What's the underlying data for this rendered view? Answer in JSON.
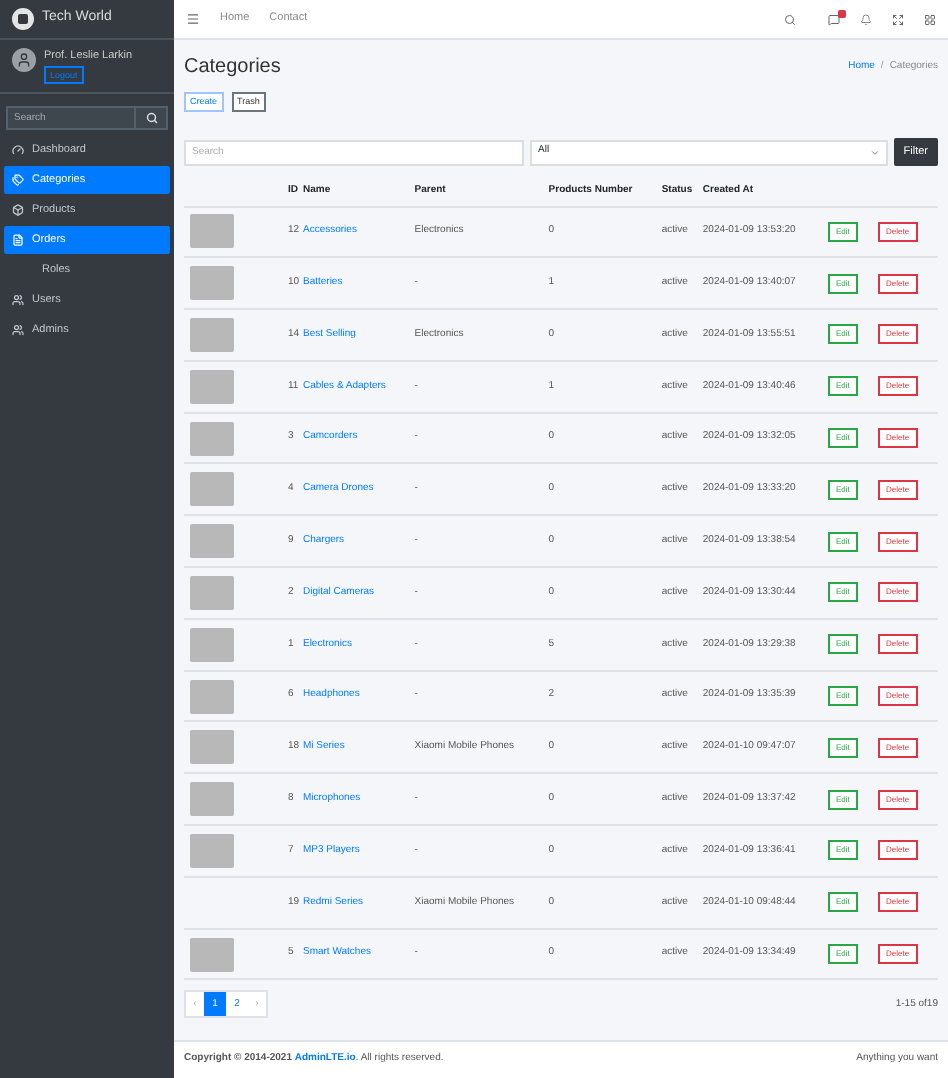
{
  "brand": "Tech World",
  "user": {
    "name": "Prof. Leslie Larkin",
    "logout": "Logout"
  },
  "sidebar": {
    "search_placeholder": "Search",
    "items": [
      {
        "label": "Dashboard",
        "kind": "main",
        "selected": false
      },
      {
        "label": "Categories",
        "kind": "main",
        "selected": true
      },
      {
        "label": "Products",
        "kind": "main",
        "selected": false
      },
      {
        "label": "Orders",
        "kind": "main",
        "selected": true
      },
      {
        "label": "Roles",
        "kind": "sub",
        "selected": false
      },
      {
        "label": "Users",
        "kind": "main",
        "selected": false
      },
      {
        "label": "Admins",
        "kind": "main",
        "selected": false
      }
    ]
  },
  "topnav": {
    "links": [
      "Home",
      "Contact"
    ]
  },
  "page_title": "Categories",
  "breadcrumb": [
    "Home",
    "/",
    "Categories"
  ],
  "actions": [
    "Create",
    "Trash"
  ],
  "filter": {
    "search_placeholder": "Search",
    "select_value": "All",
    "button": "Filter"
  },
  "table": {
    "columns": [
      "ID",
      "Name",
      "Parent",
      "Products Number",
      "Status",
      "Created At"
    ],
    "rows": [
      {
        "image": true,
        "id": "12",
        "name": "Accessories",
        "parent": "Electronics",
        "products": "0",
        "status": "active",
        "created": "2024-01-09 13:53:20"
      },
      {
        "image": true,
        "id": "10",
        "name": "Batteries",
        "parent": "-",
        "products": "1",
        "status": "active",
        "created": "2024-01-09 13:40:07"
      },
      {
        "image": true,
        "id": "14",
        "name": "Best Selling",
        "parent": "Electronics",
        "products": "0",
        "status": "active",
        "created": "2024-01-09 13:55:51"
      },
      {
        "image": true,
        "id": "11",
        "name": "Cables & Adapters",
        "parent": "-",
        "products": "1",
        "status": "active",
        "created": "2024-01-09 13:40:46"
      },
      {
        "image": true,
        "id": "3",
        "name": "Camcorders",
        "parent": "-",
        "products": "0",
        "status": "active",
        "created": "2024-01-09 13:32:05"
      },
      {
        "image": true,
        "id": "4",
        "name": "Camera Drones",
        "parent": "-",
        "products": "0",
        "status": "active",
        "created": "2024-01-09 13:33:20"
      },
      {
        "image": true,
        "id": "9",
        "name": "Chargers",
        "parent": "-",
        "products": "0",
        "status": "active",
        "created": "2024-01-09 13:38:54"
      },
      {
        "image": true,
        "id": "2",
        "name": "Digital Cameras",
        "parent": "-",
        "products": "0",
        "status": "active",
        "created": "2024-01-09 13:30:44"
      },
      {
        "image": true,
        "id": "1",
        "name": "Electronics",
        "parent": "-",
        "products": "5",
        "status": "active",
        "created": "2024-01-09 13:29:38"
      },
      {
        "image": true,
        "id": "6",
        "name": "Headphones",
        "parent": "-",
        "products": "2",
        "status": "active",
        "created": "2024-01-09 13:35:39"
      },
      {
        "image": true,
        "id": "18",
        "name": "Mi Series",
        "parent": "Xiaomi Mobile Phones",
        "products": "0",
        "status": "active",
        "created": "2024-01-10 09:47:07"
      },
      {
        "image": true,
        "id": "8",
        "name": "Microphones",
        "parent": "-",
        "products": "0",
        "status": "active",
        "created": "2024-01-09 13:37:42"
      },
      {
        "image": true,
        "id": "7",
        "name": "MP3 Players",
        "parent": "-",
        "products": "0",
        "status": "active",
        "created": "2024-01-09 13:36:41"
      },
      {
        "image": false,
        "id": "19",
        "name": "Redmi Series",
        "parent": "Xiaomi Mobile Phones",
        "products": "0",
        "status": "active",
        "created": "2024-01-10 09:48:44"
      },
      {
        "image": true,
        "id": "5",
        "name": "Smart Watches",
        "parent": "-",
        "products": "0",
        "status": "active",
        "created": "2024-01-09 13:34:49"
      }
    ],
    "edit": [
      "Edit",
      "Edit",
      "Edit",
      "Edit",
      "Edit",
      "Edit",
      "Edit",
      "Edit",
      "Edit",
      "Edit",
      "Edit",
      "Edit",
      "Edit",
      "Edit",
      "Edit"
    ],
    "delete": [
      "Delete",
      "Delete",
      "Delete",
      "Delete",
      "Delete",
      "Delete",
      "Delete",
      "Delete",
      "Delete",
      "Delete",
      "Delete",
      "Delete",
      "Delete",
      "Delete",
      "Delete"
    ]
  },
  "pagination": {
    "prev": "‹",
    "pages": [
      {
        "label": "1",
        "selected": true
      },
      {
        "label": "2",
        "selected": false
      }
    ],
    "next": "›",
    "summary": "1-15 of19"
  },
  "footer": {
    "copyright": "Copyright © 2014-2021",
    "link": "AdminLTE.io",
    "rights": ". All rights reserved.",
    "right": "Anything you want"
  }
}
